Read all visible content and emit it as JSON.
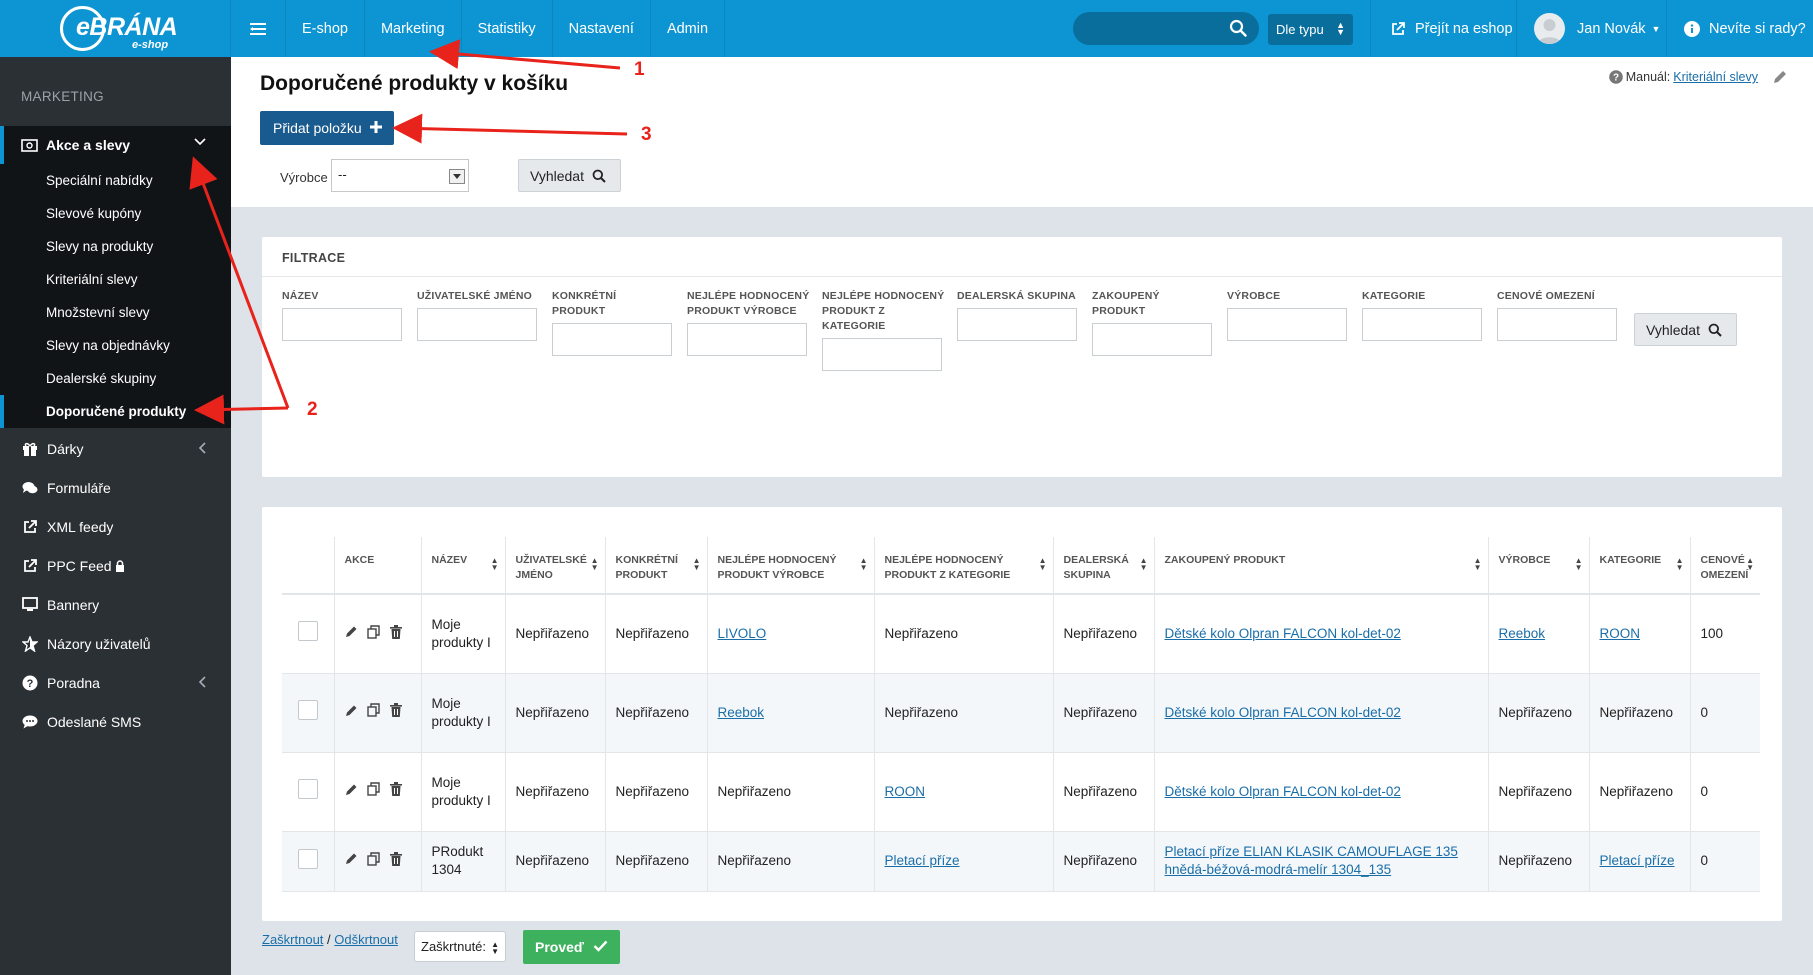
{
  "topbar": {
    "logo_brand": "eBRÁNA",
    "logo_sub": "e-shop",
    "nav": [
      "E-shop",
      "Marketing",
      "Statistiky",
      "Nastavení",
      "Admin"
    ],
    "search_placeholder": "",
    "type_select": "Dle typu",
    "goto_eshop": "Přejít na eshop",
    "user_name": "Jan Novák",
    "help": "Nevíte si rady?",
    "accent": "#0d94d2"
  },
  "sidebar": {
    "section_title": "MARKETING",
    "group_label": "Akce a slevy",
    "group_items": [
      "Speciální nabídky",
      "Slevové kupóny",
      "Slevy na produkty",
      "Kriteriální slevy",
      "Množstevní slevy",
      "Slevy na objednávky",
      "Dealerské skupiny",
      "Doporučené produkty"
    ],
    "items": [
      {
        "label": "Dárky",
        "icon": "gift-icon"
      },
      {
        "label": "Formuláře",
        "icon": "comments-icon"
      },
      {
        "label": "XML feedy",
        "icon": "external-link-icon"
      },
      {
        "label": "PPC Feed",
        "icon": "external-link-icon"
      },
      {
        "label": "Bannery",
        "icon": "monitor-icon"
      },
      {
        "label": "Názory uživatelů",
        "icon": "star-icon"
      },
      {
        "label": "Poradna",
        "icon": "question-icon"
      },
      {
        "label": "Odeslané SMS",
        "icon": "comment-icon"
      }
    ]
  },
  "page": {
    "title": "Doporučené produkty v košíku",
    "manual_label": "Manuál:",
    "manual_link": "Kriteriální slevy",
    "add_button": "Přidat položku",
    "manufacturer_label": "Výrobce",
    "manufacturer_value": "--",
    "search_button": "Vyhledat"
  },
  "filter": {
    "title": "FILTRACE",
    "fields": [
      "NÁZEV",
      "UŽIVATELSKÉ JMÉNO",
      "KONKRÉTNÍ PRODUKT",
      "NEJLÉPE HODNOCENÝ PRODUKT VÝROBCE",
      "NEJLÉPE HODNOCENÝ PRODUKT Z KATEGORIE",
      "DEALERSKÁ SKUPINA",
      "ZAKOUPENÝ PRODUKT",
      "VÝROBCE",
      "KATEGORIE",
      "CENOVÉ OMEZENÍ"
    ],
    "search_button": "Vyhledat"
  },
  "table": {
    "columns": [
      "",
      "AKCE",
      "NÁZEV",
      "UŽIVATELSKÉ JMÉNO",
      "KONKRÉTNÍ PRODUKT",
      "NEJLÉPE HODNOCENÝ PRODUKT VÝROBCE",
      "NEJLÉPE HODNOCENÝ PRODUKT Z KATEGORIE",
      "DEALERSKÁ SKUPINA",
      "ZAKOUPENÝ PRODUKT",
      "VÝROBCE",
      "KATEGORIE",
      "CENOVÉ OMEZENÍ"
    ],
    "rows": [
      {
        "name": "Moje produkty I",
        "user": "Nepřiřazeno",
        "product": "Nepřiřazeno",
        "best_mfr": "LIVOLO",
        "best_cat": "Nepřiřazeno",
        "dealer": "Nepřiřazeno",
        "bought": "Dětské kolo Olpran FALCON kol-det-02",
        "mfr": "Reebok",
        "cat": "ROON",
        "price": "100"
      },
      {
        "name": "Moje produkty I",
        "user": "Nepřiřazeno",
        "product": "Nepřiřazeno",
        "best_mfr": "Reebok",
        "best_cat": "Nepřiřazeno",
        "dealer": "Nepřiřazeno",
        "bought": "Dětské kolo Olpran FALCON kol-det-02",
        "mfr": "Nepřiřazeno",
        "cat": "Nepřiřazeno",
        "price": "0"
      },
      {
        "name": "Moje produkty I",
        "user": "Nepřiřazeno",
        "product": "Nepřiřazeno",
        "best_mfr": "Nepřiřazeno",
        "best_cat": "ROON",
        "dealer": "Nepřiřazeno",
        "bought": "Dětské kolo Olpran FALCON kol-det-02",
        "mfr": "Nepřiřazeno",
        "cat": "Nepřiřazeno",
        "price": "0"
      },
      {
        "name": "PRodukt 1304",
        "user": "Nepřiřazeno",
        "product": "Nepřiřazeno",
        "best_mfr": "Nepřiřazeno",
        "best_cat": "Pletací příze",
        "dealer": "Nepřiřazeno",
        "bought": "Pletací příze ELIAN KLASIK CAMOUFLAGE 135 hnědá-béžová-modrá-melír 1304_135",
        "mfr": "Nepřiřazeno",
        "cat": "Pletací příze",
        "price": "0"
      }
    ]
  },
  "footer": {
    "check": "Zaškrtnout",
    "separator": "/",
    "uncheck": "Odškrtnout",
    "bulk_select": "Zaškrtnuté:",
    "go_button": "Proveď"
  },
  "annotations": [
    "1",
    "2",
    "3"
  ]
}
